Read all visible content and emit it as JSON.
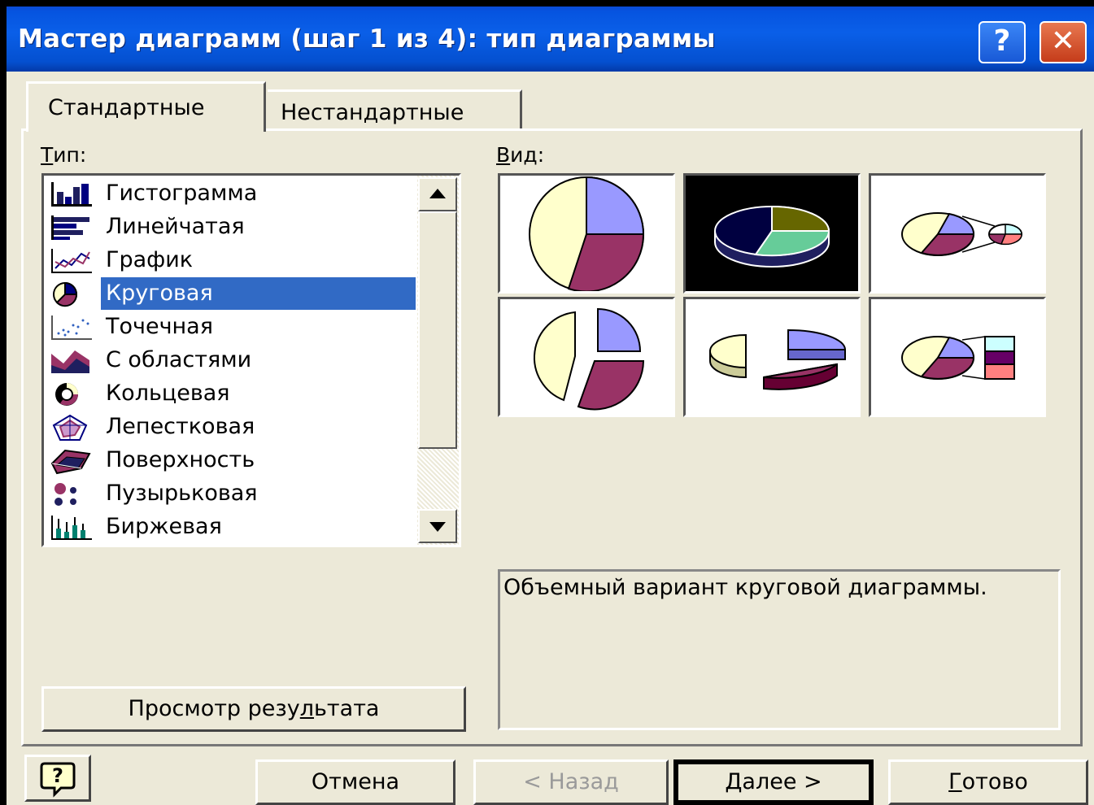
{
  "window": {
    "title": "Мастер диаграмм (шаг 1 из 4): тип диаграммы",
    "help_glyph": "?",
    "close_glyph": "✕"
  },
  "tabs": [
    {
      "label": "Стандартные",
      "selected": true
    },
    {
      "label": "Нестандартные",
      "selected": false
    }
  ],
  "type_label": {
    "accel": "Т",
    "rest": "ип:"
  },
  "view_label": {
    "accel": "В",
    "rest": "ид:"
  },
  "chart_types": [
    {
      "label": "Гистограмма",
      "icon": "column-chart-icon"
    },
    {
      "label": "Линейчатая",
      "icon": "bar-chart-icon"
    },
    {
      "label": "График",
      "icon": "line-chart-icon"
    },
    {
      "label": "Круговая",
      "icon": "pie-chart-icon",
      "selected": true
    },
    {
      "label": "Точечная",
      "icon": "scatter-chart-icon"
    },
    {
      "label": "С областями",
      "icon": "area-chart-icon"
    },
    {
      "label": "Кольцевая",
      "icon": "doughnut-chart-icon"
    },
    {
      "label": "Лепестковая",
      "icon": "radar-chart-icon"
    },
    {
      "label": "Поверхность",
      "icon": "surface-chart-icon"
    },
    {
      "label": "Пузырьковая",
      "icon": "bubble-chart-icon"
    },
    {
      "label": "Биржевая",
      "icon": "stock-chart-icon"
    }
  ],
  "subtypes": [
    {
      "icon": "pie-icon",
      "selected": false
    },
    {
      "icon": "pie-3d-icon",
      "selected": true
    },
    {
      "icon": "pie-of-pie-icon",
      "selected": false
    },
    {
      "icon": "exploded-pie-icon",
      "selected": false
    },
    {
      "icon": "exploded-pie-3d-icon",
      "selected": false
    },
    {
      "icon": "bar-of-pie-icon",
      "selected": false
    }
  ],
  "description": "Объемный вариант круговой диаграммы.",
  "buttons": {
    "preview": {
      "before": "Просмотр резу",
      "accel": "л",
      "after": "ьтата"
    },
    "cancel": "Отмена",
    "back": "< Назад",
    "next": "Далее >",
    "finish": {
      "accel": "Г",
      "rest": "отово"
    },
    "office_help_glyph": "?"
  },
  "colors": {
    "selection": "#316AC5",
    "title_bar": "#0A5FE8",
    "dialog_bg": "#ECE9D8",
    "pie_yellow": "#FFFFCC",
    "pie_blue": "#9999FF",
    "pie_maroon": "#993366"
  }
}
